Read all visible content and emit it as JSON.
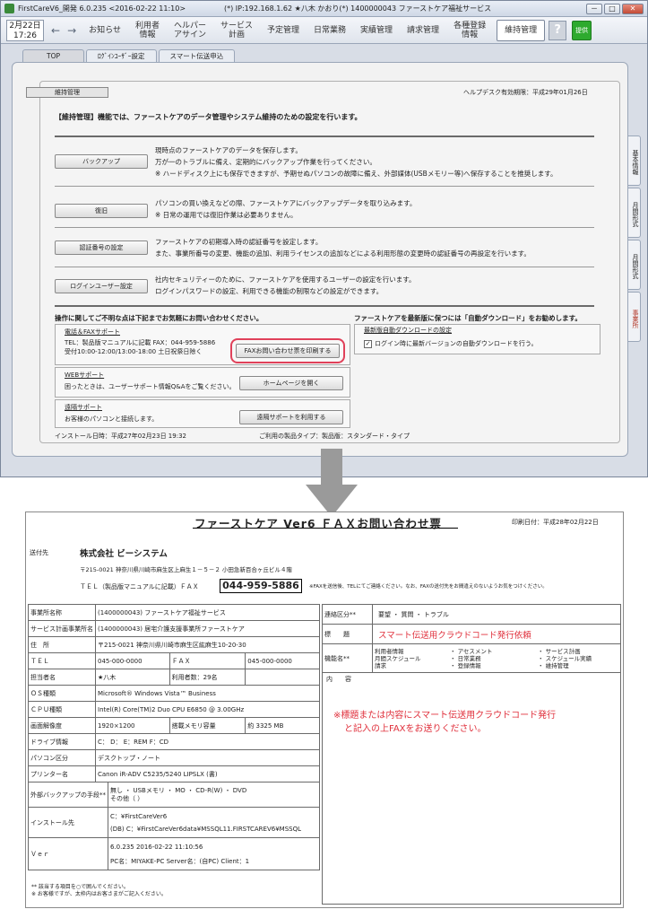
{
  "window": {
    "title_left": "FirstCareV6_開発 6.0.235 <2016-02-22 11:10>",
    "title_center": "(*) IP:192.168.1.62 ★八木 かおり(*) 1400000043 ファーストケア福祉サービス",
    "min": "－",
    "max": "□",
    "close": "✕"
  },
  "menubar": {
    "date": "2月22日",
    "time": "17:26",
    "back": "←",
    "forward": "→",
    "items": [
      {
        "label": "お知らせ",
        "single": true
      },
      {
        "label": "利用者\n情報",
        "single": false
      },
      {
        "label": "ヘルパー\nアサイン",
        "single": false
      },
      {
        "label": "サービス\n計画",
        "single": false
      },
      {
        "label": "予定管理",
        "single": true
      },
      {
        "label": "日常業務",
        "single": true
      },
      {
        "label": "実績管理",
        "single": true
      },
      {
        "label": "請求管理",
        "single": true
      },
      {
        "label": "各種登録\n情報",
        "single": false
      }
    ],
    "active_item": "維持管理",
    "help": "?",
    "teikyo": "提供"
  },
  "subtabs": [
    "TOP",
    "ﾛｸﾞｲﾝﾕｰｻﾞｰ設定",
    "スマート伝送申込"
  ],
  "side_tabs": [
    "基本情報",
    "月間形式",
    "月間形式",
    "事業所"
  ],
  "maint": {
    "section_label": "維持管理",
    "helpdesk": "ヘルプデスク有効期限：平成29年01月26日",
    "intro": "【維持管理】機能では、ファーストケアのデータ管理やシステム維持のための設定を行います。",
    "ops": [
      {
        "button": "バックアップ",
        "text": "現時点のファーストケアのデータを保存します。\n万が一のトラブルに備え、定期的にバックアップ作業を行ってください。\n※ ハードディスク上にも保存できますが、予期せぬパソコンの故障に備え、外部媒体(USBメモリー等)へ保存することを推奨します。"
      },
      {
        "button": "復旧",
        "text": "パソコンの買い換えなどの際、ファーストケアにバックアップデータを取り込みます。\n※ 日常の運用では復旧作業は必要ありません。"
      },
      {
        "button": "認証番号の設定",
        "text": "ファーストケアの初期導入時の認証番号を設定します。\nまた、事業所番号の変更、機能の追加、利用ライセンスの追加などによる利用形態の変更時の認証番号の再設定を行います。"
      },
      {
        "button": "ログインユーザー設定",
        "text": "社内セキュリティーのために、ファーストケアを使用するユーザーの設定を行います。\nログインパスワードの設定、利用できる機能の制限などの設定ができます。"
      }
    ],
    "contact_title": "操作に関してご不明な点は下記までお気軽にお問い合わせください。",
    "update_title": "ファーストケアを最新版に保つには「自動ダウンロード」をお勧めします。",
    "phone": {
      "heading": "電話＆FAXサポート",
      "body": "TEL：製品版マニュアルに記載  FAX：044-959-5886\n受付10:00-12:00/13:00-18:00 土日祝祭日除く",
      "button": "FAXお問い合わせ票を印刷する"
    },
    "web": {
      "heading": "WEBサポート",
      "body": "困ったときは、ユーザーサポート情報Q&Aをご覧ください。",
      "button": "ホームページを開く"
    },
    "remote": {
      "heading": "遠隔サポート",
      "body": "お客様のパソコンと接続します。",
      "button": "遠隔サポートを利用する"
    },
    "update": {
      "heading": "最新版自動ダウンロードの設定",
      "check_mark": "✓",
      "check_label": "ログイン時に最新バージョンの自動ダウンロードを行う。"
    },
    "install_date": "インストール日時：平成27年02月23日 19:32",
    "product_type": "ご利用の製品タイプ：製品版：スタンダード・タイプ"
  },
  "fax": {
    "title": "ファーストケア Ver6  ＦＡＸお問い合わせ票",
    "print_date": "印刷日付：平成28年02月22日",
    "dest_label": "送付先",
    "company": "株式会社 ビーシステム",
    "address": "〒215-0021 神奈川県川崎市麻生区上麻生１－５－２ 小田急新百合ヶ丘ビル４階",
    "tel_fax_label": "ＴＥＬ（製品版マニュアルに記載）ＦＡＸ",
    "fax_number": "044-959-5886",
    "fax_note": "※FAXを送信後、TELにてご連絡ください。なお、FAXの送付先をお間違えのないようお気をつけください。",
    "left_rows": [
      {
        "label": "事業所名称",
        "value": "(1400000043) ファーストケア福祉サービス"
      },
      {
        "label": "サービス計画事業所名",
        "value": "(1400000043) 居宅介護支援事業所ファーストケア"
      },
      {
        "label": "住　所",
        "value": "〒215-0021 神奈川県川崎市麻生区紘麻生10-20-30"
      },
      {
        "label": "ＴＥＬ",
        "value": "045-000-0000",
        "label2": "ＦＡＸ",
        "value2": "045-000-0000"
      },
      {
        "label": "担当者名",
        "value": "★八木",
        "label2": "利用者数：29名",
        "value2": ""
      },
      {
        "label": "ＯＳ種類",
        "value": "Microsoft® Windows Vista™ Business"
      },
      {
        "label": "ＣＰＵ種類",
        "value": "Intel(R) Core(TM)2 Duo CPU    E6850  @ 3.00GHz"
      },
      {
        "label": "画面解像度",
        "value": "1920×1200",
        "label2": "搭載メモリ容量",
        "value2": "約 3325 MB"
      },
      {
        "label": "ドライブ情報",
        "value": "C： D： E：REM F：CD"
      },
      {
        "label": "パソコン区分",
        "value": "デスクトップ・ノート"
      },
      {
        "label": "プリンター名",
        "value": "Canon iR-ADV C5235/5240 LIPSLX (書)"
      }
    ],
    "backup": {
      "label": "外部バックアップの手段**",
      "line1": "無し ・ USBメモリ ・ MO ・ CD-R(W) ・ DVD",
      "line2": "その他（                        ）"
    },
    "install": {
      "label": "インストール先",
      "line1": "C：¥FirstCareVer6",
      "line2": "(DB) C：¥FirstCareVer6data¥MSSQL11.FIRSTCAREV6¥MSSQL"
    },
    "version": {
      "label": "Ｖｅｒ",
      "line1": "6.0.235 2016-02-22 11:10:56",
      "line2": "PC名：MIYAKE-PC Server名：(自PC) Client：1"
    },
    "footnote1": "** 該当する項目を○で囲んでください。",
    "footnote2": "※ お客様ですが、太枠内はお客さまがご記入ください。",
    "right": {
      "contact_label": "連絡区分**",
      "contact_options": "要望  ・  質問  ・  トラブル",
      "subject_label": "標　　題",
      "subject_value": "スマート伝送用クラウドコード発行依頼",
      "func_label": "機能名**",
      "func_col1": "利用者情報\n月間スケジュール\n請求",
      "func_col2": "・  アセスメント\n・  日常業務\n・  登録情報",
      "func_col3": "・  サービス計画\n・  スケジュール実績\n・  維持管理",
      "content_label": "内　　容",
      "note_line1": "※標題または内容にスマート伝送用クラウドコード発行",
      "note_line2": "と記入の上FAXをお送りください。"
    }
  }
}
